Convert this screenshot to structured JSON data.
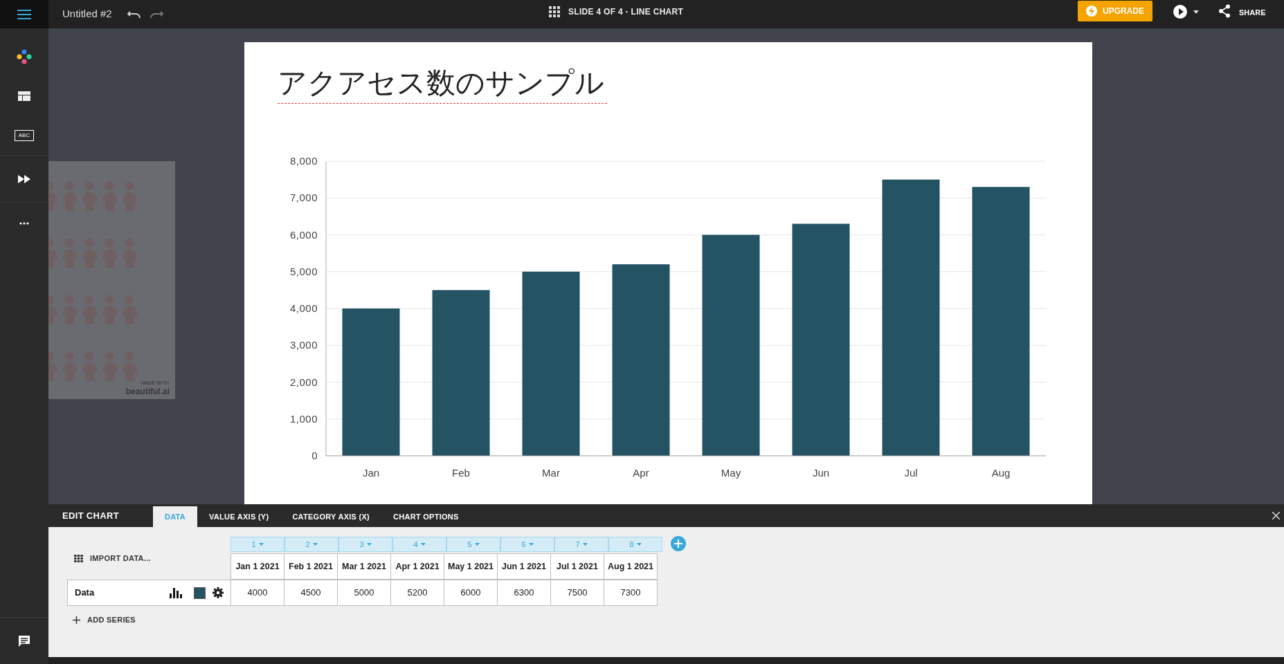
{
  "top_bar": {
    "doc_title": "Untitled #2",
    "slide_label": "SLIDE 4 OF 4 - LINE CHART",
    "upgrade_button": "UPGRADE",
    "share_label": "SHARE"
  },
  "sidebar": {
    "text_tool_label": "ABC"
  },
  "thumbnail": {
    "made_with": "MADE WITH",
    "brand": "beautiful.ai"
  },
  "slide": {
    "title": "アクアセス数のサンプル",
    "chart_data": {
      "type": "bar",
      "categories": [
        "Jan",
        "Feb",
        "Mar",
        "Apr",
        "May",
        "Jun",
        "Jul",
        "Aug"
      ],
      "grid": true,
      "series": [
        {
          "color": "#245364",
          "values": [
            4000,
            4500,
            5000,
            5200,
            6000,
            6300,
            7500,
            7300
          ]
        }
      ],
      "ylim": [
        0,
        8000
      ],
      "yticks": [
        {
          "value": 0,
          "label": "0"
        },
        {
          "value": 1000,
          "label": "1,000"
        },
        {
          "value": 2000,
          "label": "2,000"
        },
        {
          "value": 3000,
          "label": "3,000"
        },
        {
          "value": 4000,
          "label": "4,000"
        },
        {
          "value": 5000,
          "label": "5,000"
        },
        {
          "value": 6000,
          "label": "6,000"
        },
        {
          "value": 7000,
          "label": "7,000"
        },
        {
          "value": 8000,
          "label": "8,000"
        }
      ]
    }
  },
  "editor": {
    "title": "EDIT CHART",
    "tabs": [
      {
        "label": "DATA",
        "selected": true
      },
      {
        "label": "VALUE AXIS (Y)",
        "selected": false
      },
      {
        "label": "CATEGORY AXIS (X)",
        "selected": false
      },
      {
        "label": "CHART OPTIONS",
        "selected": false
      }
    ],
    "import_label": "IMPORT DATA...",
    "columns": [
      "1",
      "2",
      "3",
      "4",
      "5",
      "6",
      "7",
      "8"
    ],
    "dates": [
      "Jan 1 2021",
      "Feb 1 2021",
      "Mar 1 2021",
      "Apr 1 2021",
      "May 1 2021",
      "Jun 1 2021",
      "Jul 1 2021",
      "Aug 1 2021"
    ],
    "series": [
      {
        "name": "Data",
        "color": "#245364",
        "values": [
          "4000",
          "4500",
          "5000",
          "5200",
          "6000",
          "6300",
          "7500",
          "7300"
        ]
      }
    ],
    "add_series": "ADD SERIES"
  }
}
